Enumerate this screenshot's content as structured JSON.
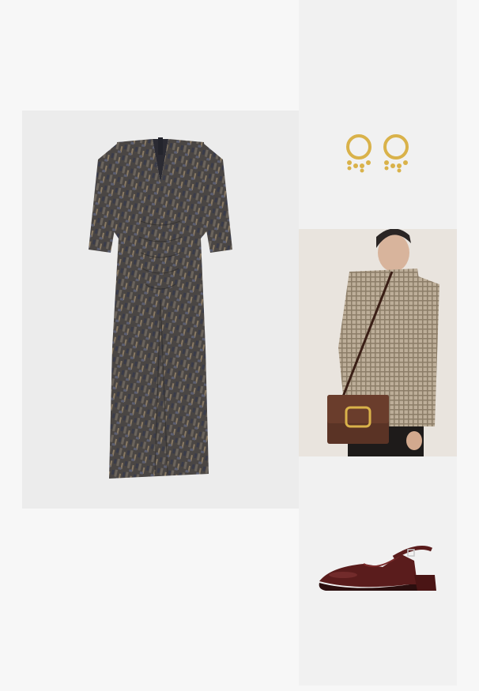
{
  "outfit": {
    "items": [
      {
        "id": "dress",
        "name": "",
        "icon": "dress-image"
      },
      {
        "id": "earrings",
        "name": "",
        "icon": "earrings-image"
      },
      {
        "id": "bag",
        "name": "",
        "icon": "crossbody-bag-image"
      },
      {
        "id": "shoes",
        "name": "",
        "icon": "slingback-shoe-image"
      }
    ]
  },
  "colors": {
    "page_background": "#f7f7f7",
    "dress_base": "#4d4a48",
    "gold": "#d9b24a",
    "bag_brown": "#5a3325",
    "jacket_check": "#b9ab97",
    "shoe_burgundy": "#5a1c1c"
  }
}
